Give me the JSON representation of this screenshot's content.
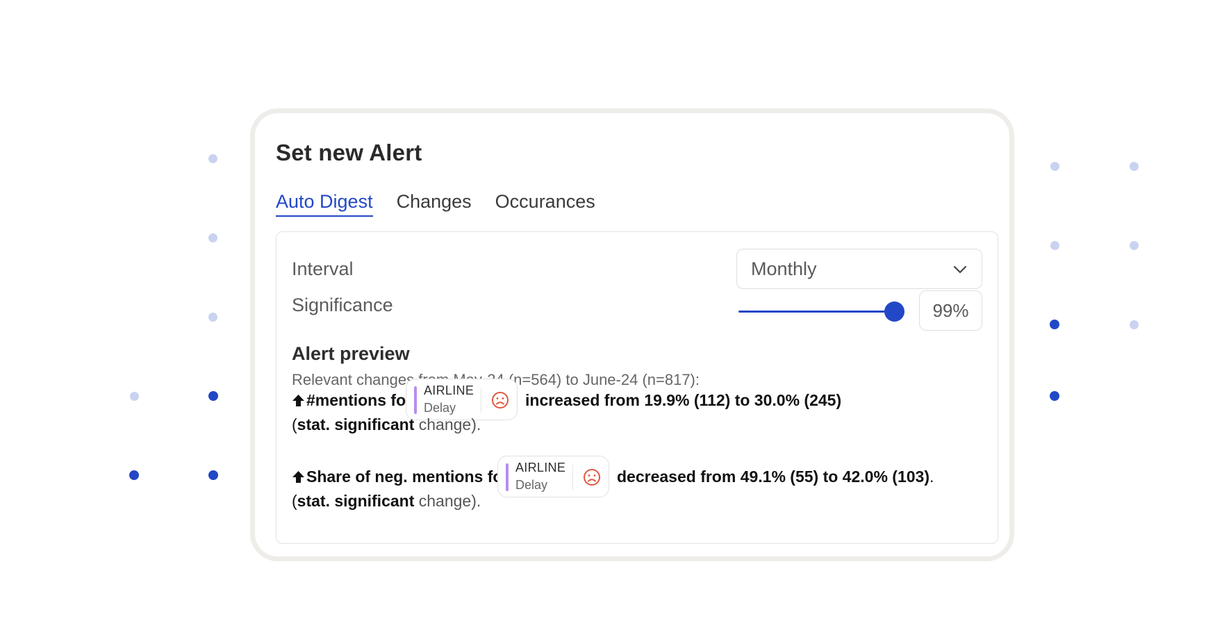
{
  "title": "Set new Alert",
  "tabs": [
    {
      "label": "Auto Digest",
      "active": true
    },
    {
      "label": "Changes",
      "active": false
    },
    {
      "label": "Occurances",
      "active": false
    }
  ],
  "interval": {
    "label": "Interval",
    "value": "Monthly"
  },
  "significance": {
    "label": "Significance",
    "value_text": "99%",
    "level": 0.99
  },
  "preview": {
    "title": "Alert preview",
    "subtitle": "Relevant changes from May-24 (n=564) to June-24 (n=817):",
    "alerts": [
      {
        "lead": "#mentions for",
        "chip": {
          "category": "AIRLINE",
          "topic": "Delay",
          "sentiment_icon": "frown-face-icon"
        },
        "change": "increased from 19.9% (112) to 30.0% (245)",
        "trailing": "",
        "note_open": "(",
        "note_bold": "stat. significant",
        "note_rest": " change)."
      },
      {
        "lead": "Share of neg. mentions for",
        "chip": {
          "category": "AIRLINE",
          "topic": "Delay",
          "sentiment_icon": "frown-face-icon"
        },
        "change": "decreased from 49.1% (55) to 42.0% (103)",
        "trailing": ".",
        "note_open": "(",
        "note_bold": "stat. significant",
        "note_rest": " change)."
      }
    ]
  },
  "colors": {
    "accent": "#2248c6",
    "dot_light": "#c9d3f0",
    "chip_bar": "#b98ded",
    "sentiment_negative": "#e0573d"
  }
}
